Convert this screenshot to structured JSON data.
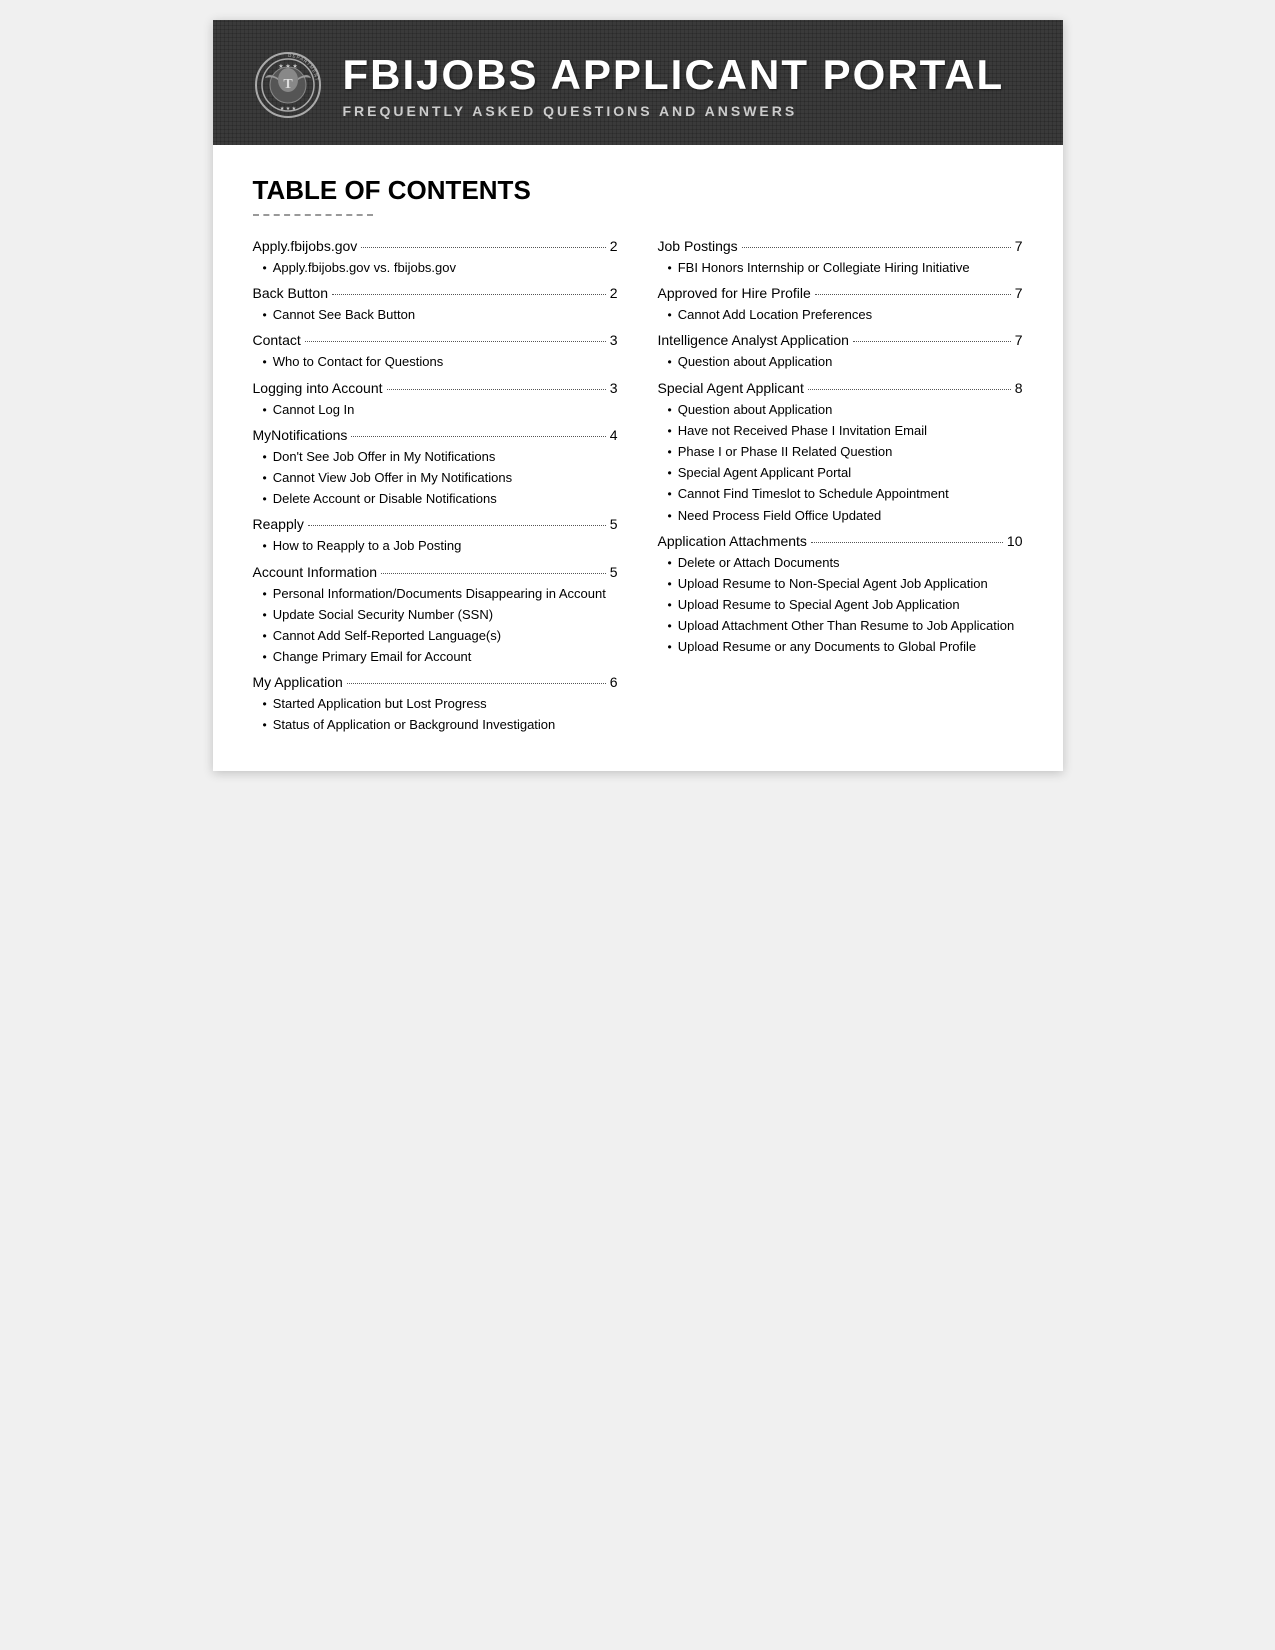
{
  "header": {
    "title": "FBIJOBS APPLICANT PORTAL",
    "subtitle": "FREQUENTLY ASKED QUESTIONS AND ANSWERS"
  },
  "toc": {
    "title": "TABLE OF CONTENTS",
    "left_column": [
      {
        "type": "main",
        "text": "Apply.fbijobs.gov",
        "page": "2",
        "sub_items": [
          "Apply.fbijobs.gov vs. fbijobs.gov"
        ]
      },
      {
        "type": "main",
        "text": "Back Button",
        "page": "2",
        "sub_items": [
          "Cannot See Back Button"
        ]
      },
      {
        "type": "main",
        "text": "Contact",
        "page": "3",
        "sub_items": [
          "Who to Contact for Questions"
        ]
      },
      {
        "type": "main",
        "text": "Logging into Account",
        "page": "3",
        "sub_items": [
          "Cannot Log In"
        ]
      },
      {
        "type": "main",
        "text": "MyNotifications",
        "page": "4",
        "sub_items": [
          "Don't See Job Offer in My Notifications",
          "Cannot View Job Offer in My Notifications",
          "Delete Account or Disable Notifications"
        ]
      },
      {
        "type": "main",
        "text": "Reapply",
        "page": "5",
        "sub_items": [
          "How to Reapply to a Job Posting"
        ]
      },
      {
        "type": "main",
        "text": "Account Information",
        "page": "5",
        "sub_items": [
          "Personal Information/Documents Disappearing in Account",
          "Update Social Security Number (SSN)",
          "Cannot Add Self-Reported Language(s)",
          "Change Primary Email for Account"
        ]
      },
      {
        "type": "main",
        "text": "My Application",
        "page": "6",
        "sub_items": [
          "Started Application but Lost Progress",
          "Status of Application or Background Investigation"
        ]
      }
    ],
    "right_column": [
      {
        "type": "main",
        "text": "Job Postings",
        "page": "7",
        "sub_items": [
          "FBI Honors Internship or Collegiate Hiring Initiative"
        ]
      },
      {
        "type": "main",
        "text": "Approved for Hire Profile",
        "page": "7",
        "sub_items": [
          "Cannot Add Location Preferences"
        ]
      },
      {
        "type": "main",
        "text": "Intelligence Analyst Application",
        "page": "7",
        "sub_items": [
          "Question about Application"
        ]
      },
      {
        "type": "main",
        "text": "Special Agent Applicant",
        "page": "8",
        "sub_items": [
          "Question about Application",
          "Have not Received Phase I Invitation Email",
          "Phase I or Phase II Related Question",
          "Special Agent Applicant Portal",
          "Cannot Find Timeslot to Schedule Appointment",
          "Need Process Field Office Updated"
        ]
      },
      {
        "type": "main",
        "text": "Application Attachments",
        "page": "10",
        "sub_items": [
          "Delete or Attach Documents",
          "Upload Resume to Non-Special Agent Job Application",
          "Upload Resume to Special Agent Job Application",
          "Upload Attachment Other Than Resume to Job Application",
          "Upload Resume or any Documents to Global Profile"
        ]
      }
    ]
  }
}
